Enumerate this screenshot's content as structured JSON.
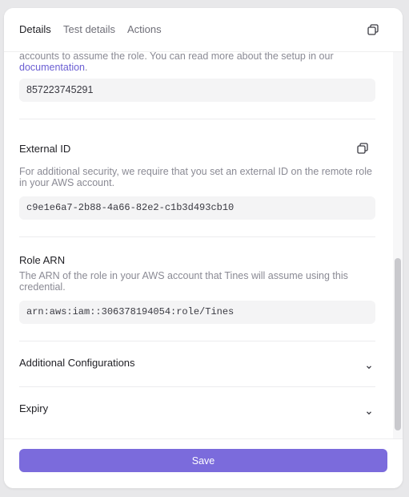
{
  "tabs": {
    "details": "Details",
    "test_details": "Test details",
    "actions": "Actions"
  },
  "intro": {
    "text": "accounts to assume the role. You can read more about the setup in our",
    "link_text": "documentation",
    "link_suffix": "."
  },
  "account_id": {
    "value": "857223745291"
  },
  "external_id": {
    "label": "External ID",
    "description": "For additional security, we require that you set an external ID on the remote role in your AWS account.",
    "value": "c9e1e6a7-2b88-4a66-82e2-c1b3d493cb10"
  },
  "role_arn": {
    "label": "Role ARN",
    "description": "The ARN of the role in your AWS account that Tines will assume using this credential.",
    "value": "arn:aws:iam::306378194054:role/Tines"
  },
  "sections": {
    "additional": "Additional Configurations",
    "expiry": "Expiry"
  },
  "footer": {
    "save_label": "Save"
  },
  "colors": {
    "accent": "#7b6bdc",
    "link": "#6b5fd3"
  },
  "icons": {
    "copy": "copy-icon",
    "chevron": "chevron-down-icon"
  }
}
